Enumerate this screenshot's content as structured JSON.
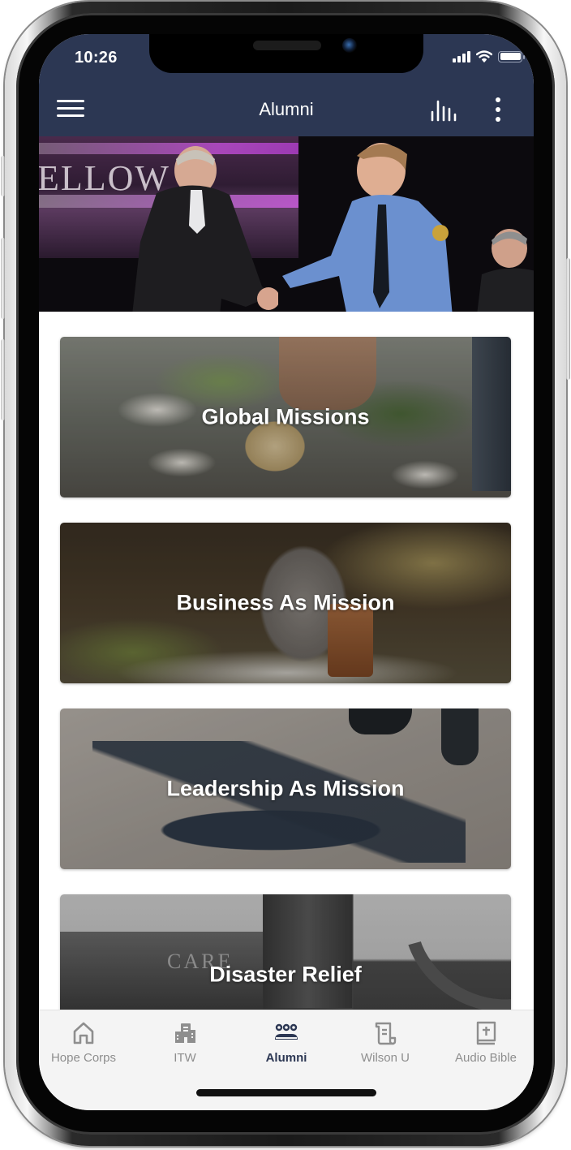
{
  "status_bar": {
    "time": "10:26",
    "icons": [
      "cellular-signal-icon",
      "wifi-icon",
      "battery-icon"
    ]
  },
  "header": {
    "title": "Alumni",
    "left_icon": "hamburger-menu-icon",
    "right_icons": [
      "audio-equalizer-icon",
      "more-vertical-icon"
    ]
  },
  "hero": {
    "image": "handshake-on-stage-photo",
    "banner_text": "ELLOW"
  },
  "cards": [
    {
      "label": "Global Missions",
      "image": "hand-on-globe-photo"
    },
    {
      "label": "Business As Mission",
      "image": "man-with-satchel-on-path-photo"
    },
    {
      "label": "Leadership As Mission",
      "image": "person-shadow-on-pavement-photo"
    },
    {
      "label": "Disaster Relief",
      "image": "black-and-white-city-photo",
      "image_text": "CARE"
    }
  ],
  "tabbar": {
    "active_index": 2,
    "items": [
      {
        "label": "Hope Corps",
        "icon": "home-icon"
      },
      {
        "label": "ITW",
        "icon": "buildings-icon"
      },
      {
        "label": "Alumni",
        "icon": "group-icon"
      },
      {
        "label": "Wilson U",
        "icon": "scroll-icon"
      },
      {
        "label": "Audio Bible",
        "icon": "bible-icon"
      }
    ]
  },
  "colors": {
    "header_bg": "#2c3753",
    "tab_active": "#2c3753",
    "tab_inactive": "#8e8e8e",
    "tabbar_bg": "#f4f4f4"
  }
}
